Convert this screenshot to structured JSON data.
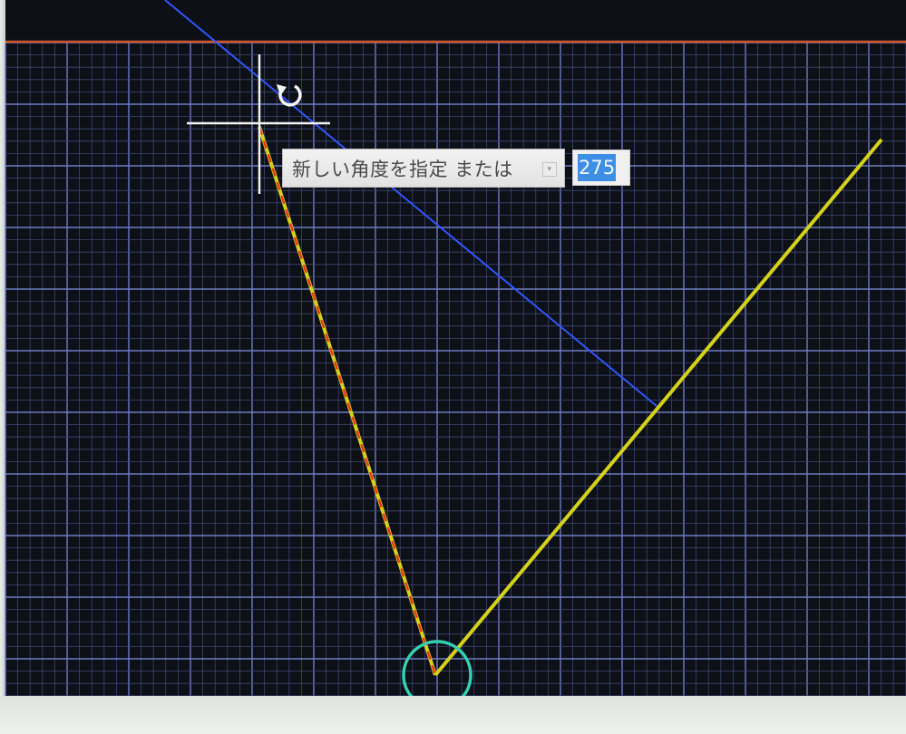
{
  "prompt": {
    "text": "新しい角度を指定 または",
    "dropdown_icon": "chevron-down-icon"
  },
  "input": {
    "value": "275"
  },
  "colors": {
    "background": "#0e1018",
    "grid_minor": "#3a4670",
    "grid_major": "#6d7cc0",
    "border_line": "#d2562a",
    "reference_line": "#2f55ff",
    "yellow_line": "#d4d21a",
    "red_dash": "#e83a1a",
    "crosshair": "#f2f2f2",
    "snap_marker": "#35d0b0",
    "input_highlight": "#3d8fe6"
  },
  "cursor": {
    "icon": "rotate-icon"
  }
}
